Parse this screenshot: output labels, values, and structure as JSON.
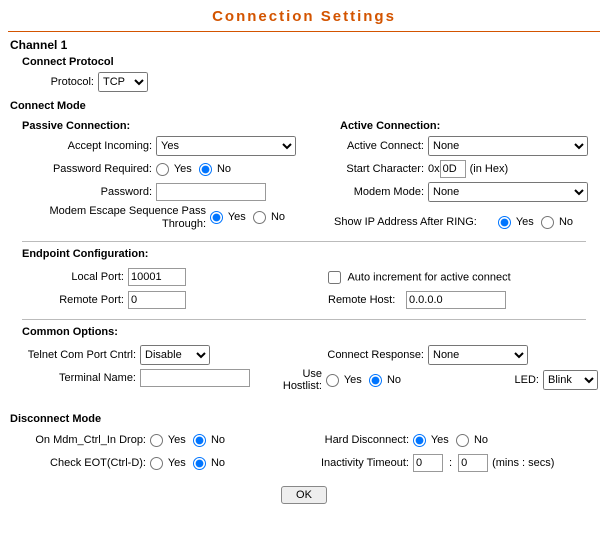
{
  "title": "Connection Settings",
  "channel_header": "Channel 1",
  "connect_protocol": {
    "heading": "Connect Protocol",
    "protocol_label": "Protocol:",
    "protocol_value": "TCP"
  },
  "connect_mode_header": "Connect Mode",
  "passive_connection": {
    "heading": "Passive Connection:",
    "accept_incoming_label": "Accept Incoming:",
    "accept_incoming_value": "Yes",
    "password_required_label": "Password Required:",
    "password_required_yes": "Yes",
    "password_required_no": "No",
    "password_label": "Password:",
    "password_value": "",
    "mesp_label": "Modem Escape Sequence Pass Through:",
    "mesp_yes": "Yes",
    "mesp_no": "No"
  },
  "active_connection": {
    "heading": "Active Connection:",
    "active_connect_label": "Active Connect:",
    "active_connect_value": "None",
    "start_char_label": "Start Character:",
    "start_char_prefix": "0x",
    "start_char_value": "0D",
    "start_char_suffix": "(in Hex)",
    "modem_mode_label": "Modem Mode:",
    "modem_mode_value": "None",
    "show_ip_label": "Show IP Address After RING:",
    "show_ip_yes": "Yes",
    "show_ip_no": "No"
  },
  "endpoint": {
    "heading": "Endpoint Configuration:",
    "local_port_label": "Local Port:",
    "local_port_value": "10001",
    "remote_port_label": "Remote Port:",
    "remote_port_value": "0",
    "auto_increment_label": "Auto increment for active connect",
    "remote_host_label": "Remote Host:",
    "remote_host_value": "0.0.0.0"
  },
  "common": {
    "heading": "Common Options:",
    "telnet_label": "Telnet Com Port Cntrl:",
    "telnet_value": "Disable",
    "connect_response_label": "Connect Response:",
    "connect_response_value": "None",
    "terminal_name_label": "Terminal Name:",
    "terminal_name_value": "",
    "use_hostlist_label": "Use Hostlist:",
    "use_hostlist_yes": "Yes",
    "use_hostlist_no": "No",
    "led_label": "LED:",
    "led_value": "Blink"
  },
  "disconnect": {
    "heading": "Disconnect Mode",
    "on_mdm_label": "On Mdm_Ctrl_In Drop:",
    "on_mdm_yes": "Yes",
    "on_mdm_no": "No",
    "hard_disconnect_label": "Hard Disconnect:",
    "hard_disconnect_yes": "Yes",
    "hard_disconnect_no": "No",
    "check_eot_label": "Check EOT(Ctrl-D):",
    "check_eot_yes": "Yes",
    "check_eot_no": "No",
    "inactivity_label": "Inactivity Timeout:",
    "inactivity_mins": "0",
    "inactivity_colon": ":",
    "inactivity_secs": "0",
    "inactivity_units": "(mins : secs)"
  },
  "ok_label": "OK"
}
